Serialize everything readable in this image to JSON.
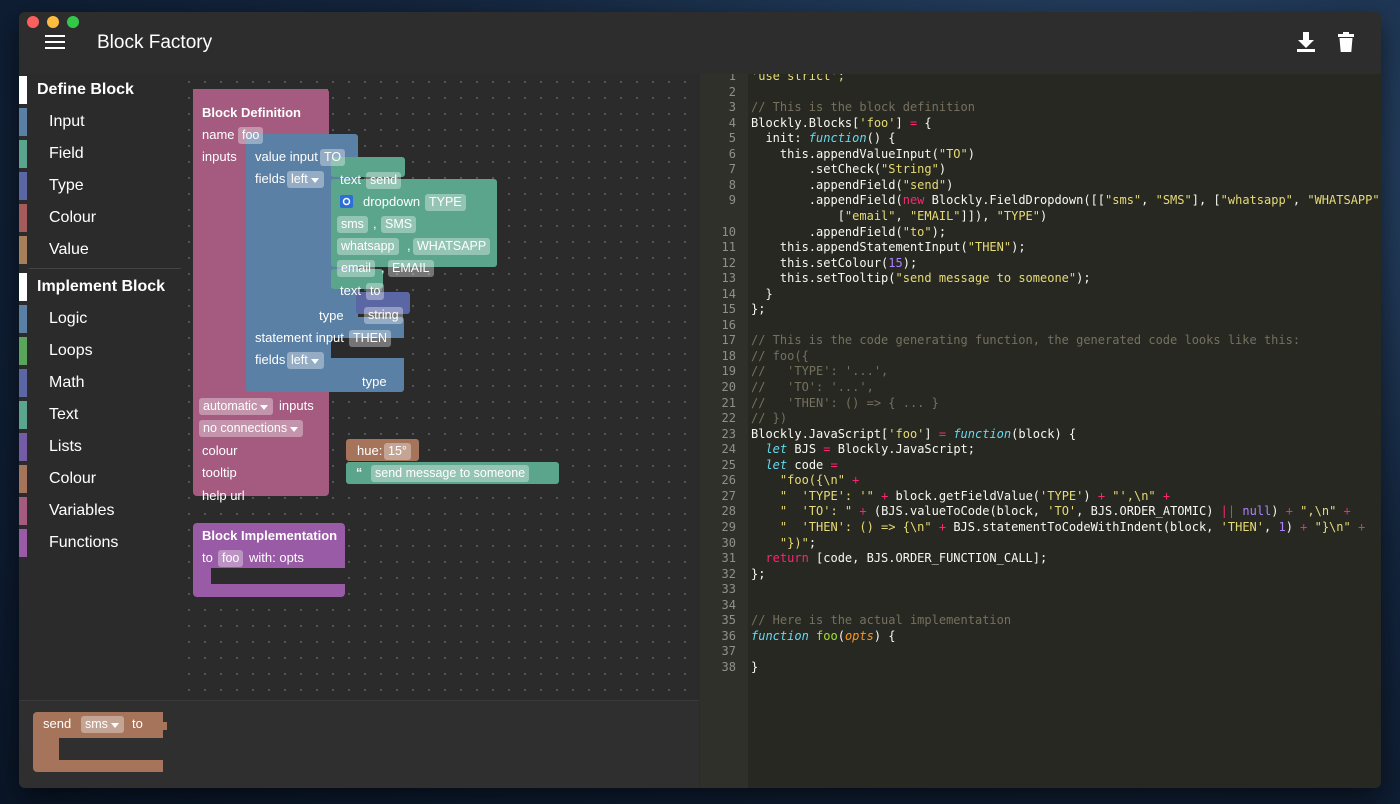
{
  "app": {
    "title": "Block Factory"
  },
  "toolbar": {
    "menu_icon": "hamburger-icon",
    "download_icon": "download-icon",
    "delete_icon": "trash-icon"
  },
  "sidebar": {
    "define": {
      "label": "Define Block",
      "items": [
        {
          "label": "Input",
          "color": "#5b80a5"
        },
        {
          "label": "Field",
          "color": "#5ba58c"
        },
        {
          "label": "Type",
          "color": "#5b67a5"
        },
        {
          "label": "Colour",
          "color": "#a55b5b"
        },
        {
          "label": "Value",
          "color": "#a5805b"
        }
      ]
    },
    "implement": {
      "label": "Implement Block",
      "items": [
        {
          "label": "Logic",
          "color": "#5b80a5"
        },
        {
          "label": "Loops",
          "color": "#5ba55b"
        },
        {
          "label": "Math",
          "color": "#5b67a5"
        },
        {
          "label": "Text",
          "color": "#5ba58c"
        },
        {
          "label": "Lists",
          "color": "#745ba5"
        },
        {
          "label": "Colour",
          "color": "#a5745b"
        },
        {
          "label": "Variables",
          "color": "#a55b80"
        },
        {
          "label": "Functions",
          "color": "#995ba5"
        }
      ]
    }
  },
  "def_block": {
    "title": "Block Definition",
    "name_label": "name",
    "name_value": "foo",
    "inputs_label": "inputs",
    "value_input_label": "value input",
    "value_input_name": "TO",
    "fields_label": "fields",
    "align_left": "left",
    "text_label": "text",
    "text_send": "send",
    "dropdown_label": "dropdown",
    "dropdown_name": "TYPE",
    "opt1_a": "sms",
    "opt1_b": "SMS",
    "opt2_a": "whatsapp",
    "opt2_b": "WHATSAPP",
    "opt3_a": "email",
    "opt3_b": "EMAIL",
    "comma": ",",
    "text_to": "to",
    "type_label": "type",
    "type_string": "string",
    "stmt_input_label": "statement input",
    "stmt_input_name": "THEN",
    "stmt_fields_label": "fields",
    "stmt_align": "left",
    "stmt_type_label": "type",
    "auto_inputs": "automatic",
    "inputs_word": "inputs",
    "connections": "no connections",
    "colour_label": "colour",
    "hue_label": "hue:",
    "hue_value": "15°",
    "tooltip_label": "tooltip",
    "quote": "“",
    "tooltip_value": "send message to someone",
    "helpurl_label": "help url"
  },
  "impl_block": {
    "title": "Block Implementation",
    "to_label": "to",
    "fn_name": "foo",
    "with_label": "with: opts"
  },
  "preview_block": {
    "send_label": "send",
    "dropdown_value": "sms",
    "to_label": "to"
  },
  "code": {
    "lines": [
      {
        "n": "1",
        "t": [
          {
            "c": "st",
            "v": "'use strict';"
          }
        ]
      },
      {
        "n": "2",
        "t": []
      },
      {
        "n": "3",
        "t": [
          {
            "c": "cm",
            "v": "// This is the block definition"
          }
        ]
      },
      {
        "n": "4",
        "t": [
          {
            "c": "pl",
            "v": "Blockly.Blocks["
          },
          {
            "c": "st",
            "v": "'foo'"
          },
          {
            "c": "pl",
            "v": "] "
          },
          {
            "c": "kw",
            "v": "="
          },
          {
            "c": "pl",
            "v": " {"
          }
        ]
      },
      {
        "n": "5",
        "t": [
          {
            "c": "pl",
            "v": "  init: "
          },
          {
            "c": "fn",
            "v": "function"
          },
          {
            "c": "pl",
            "v": "() {"
          }
        ]
      },
      {
        "n": "6",
        "t": [
          {
            "c": "pl",
            "v": "    this.appendValueInput("
          },
          {
            "c": "st",
            "v": "\"TO\""
          },
          {
            "c": "pl",
            "v": ")"
          }
        ]
      },
      {
        "n": "7",
        "t": [
          {
            "c": "pl",
            "v": "        .setCheck("
          },
          {
            "c": "st",
            "v": "\"String\""
          },
          {
            "c": "pl",
            "v": ")"
          }
        ]
      },
      {
        "n": "8",
        "t": [
          {
            "c": "pl",
            "v": "        .appendField("
          },
          {
            "c": "st",
            "v": "\"send\""
          },
          {
            "c": "pl",
            "v": ")"
          }
        ]
      },
      {
        "n": "9",
        "t": [
          {
            "c": "pl",
            "v": "        .appendField("
          },
          {
            "c": "kw",
            "v": "new"
          },
          {
            "c": "pl",
            "v": " Blockly.FieldDropdown([["
          },
          {
            "c": "st",
            "v": "\"sms\""
          },
          {
            "c": "pl",
            "v": ", "
          },
          {
            "c": "st",
            "v": "\"SMS\""
          },
          {
            "c": "pl",
            "v": "], ["
          },
          {
            "c": "st",
            "v": "\"whatsapp\""
          },
          {
            "c": "pl",
            "v": ", "
          },
          {
            "c": "st",
            "v": "\"WHATSAPP\""
          },
          {
            "c": "pl",
            "v": "],"
          }
        ]
      },
      {
        "n": "",
        "t": [
          {
            "c": "pl",
            "v": "            ["
          },
          {
            "c": "st",
            "v": "\"email\""
          },
          {
            "c": "pl",
            "v": ", "
          },
          {
            "c": "st",
            "v": "\"EMAIL\""
          },
          {
            "c": "pl",
            "v": "]]), "
          },
          {
            "c": "st",
            "v": "\"TYPE\""
          },
          {
            "c": "pl",
            "v": ")"
          }
        ]
      },
      {
        "n": "10",
        "t": [
          {
            "c": "pl",
            "v": "        .appendField("
          },
          {
            "c": "st",
            "v": "\"to\""
          },
          {
            "c": "pl",
            "v": ");"
          }
        ]
      },
      {
        "n": "11",
        "t": [
          {
            "c": "pl",
            "v": "    this.appendStatementInput("
          },
          {
            "c": "st",
            "v": "\"THEN\""
          },
          {
            "c": "pl",
            "v": ");"
          }
        ]
      },
      {
        "n": "12",
        "t": [
          {
            "c": "pl",
            "v": "    this.setColour("
          },
          {
            "c": "nu",
            "v": "15"
          },
          {
            "c": "pl",
            "v": ");"
          }
        ]
      },
      {
        "n": "13",
        "t": [
          {
            "c": "pl",
            "v": "    this.setTooltip("
          },
          {
            "c": "st",
            "v": "\"send message to someone\""
          },
          {
            "c": "pl",
            "v": ");"
          }
        ]
      },
      {
        "n": "14",
        "t": [
          {
            "c": "pl",
            "v": "  }"
          }
        ]
      },
      {
        "n": "15",
        "t": [
          {
            "c": "pl",
            "v": "};"
          }
        ]
      },
      {
        "n": "16",
        "t": []
      },
      {
        "n": "17",
        "t": [
          {
            "c": "cm",
            "v": "// This is the code generating function, the generated code looks like this:"
          }
        ]
      },
      {
        "n": "18",
        "t": [
          {
            "c": "cm",
            "v": "// foo({"
          }
        ]
      },
      {
        "n": "19",
        "t": [
          {
            "c": "cm",
            "v": "//   'TYPE': '...',"
          }
        ]
      },
      {
        "n": "20",
        "t": [
          {
            "c": "cm",
            "v": "//   'TO': '...',"
          }
        ]
      },
      {
        "n": "21",
        "t": [
          {
            "c": "cm",
            "v": "//   'THEN': () => { ... }"
          }
        ]
      },
      {
        "n": "22",
        "t": [
          {
            "c": "cm",
            "v": "// })"
          }
        ]
      },
      {
        "n": "23",
        "t": [
          {
            "c": "pl",
            "v": "Blockly.JavaScript["
          },
          {
            "c": "st",
            "v": "'foo'"
          },
          {
            "c": "pl",
            "v": "] "
          },
          {
            "c": "kw",
            "v": "="
          },
          {
            "c": "pl",
            "v": " "
          },
          {
            "c": "fn",
            "v": "function"
          },
          {
            "c": "pl",
            "v": "(block) {"
          }
        ]
      },
      {
        "n": "24",
        "t": [
          {
            "c": "pl",
            "v": "  "
          },
          {
            "c": "fn",
            "v": "let"
          },
          {
            "c": "pl",
            "v": " BJS "
          },
          {
            "c": "kw",
            "v": "="
          },
          {
            "c": "pl",
            "v": " Blockly.JavaScript;"
          }
        ]
      },
      {
        "n": "25",
        "t": [
          {
            "c": "pl",
            "v": "  "
          },
          {
            "c": "fn",
            "v": "let"
          },
          {
            "c": "pl",
            "v": " code "
          },
          {
            "c": "kw",
            "v": "="
          }
        ]
      },
      {
        "n": "26",
        "t": [
          {
            "c": "pl",
            "v": "    "
          },
          {
            "c": "st",
            "v": "\"foo({\\n\""
          },
          {
            "c": "pl",
            "v": " "
          },
          {
            "c": "kw",
            "v": "+"
          }
        ]
      },
      {
        "n": "27",
        "t": [
          {
            "c": "pl",
            "v": "    "
          },
          {
            "c": "st",
            "v": "\"  'TYPE': '\""
          },
          {
            "c": "pl",
            "v": " "
          },
          {
            "c": "kw",
            "v": "+"
          },
          {
            "c": "pl",
            "v": " block.getFieldValue("
          },
          {
            "c": "st",
            "v": "'TYPE'"
          },
          {
            "c": "pl",
            "v": ") "
          },
          {
            "c": "kw",
            "v": "+"
          },
          {
            "c": "pl",
            "v": " "
          },
          {
            "c": "st",
            "v": "\"',\\n\""
          },
          {
            "c": "pl",
            "v": " "
          },
          {
            "c": "kw",
            "v": "+"
          }
        ]
      },
      {
        "n": "28",
        "t": [
          {
            "c": "pl",
            "v": "    "
          },
          {
            "c": "st",
            "v": "\"  'TO': \""
          },
          {
            "c": "pl",
            "v": " "
          },
          {
            "c": "kw",
            "v": "+"
          },
          {
            "c": "pl",
            "v": " (BJS.valueToCode(block, "
          },
          {
            "c": "st",
            "v": "'TO'"
          },
          {
            "c": "pl",
            "v": ", BJS.ORDER_ATOMIC) "
          },
          {
            "c": "kw",
            "v": "||"
          },
          {
            "c": "pl",
            "v": " "
          },
          {
            "c": "nu",
            "v": "null"
          },
          {
            "c": "pl",
            "v": ") "
          },
          {
            "c": "kw",
            "v": "+"
          },
          {
            "c": "pl",
            "v": " "
          },
          {
            "c": "st",
            "v": "\",\\n\""
          },
          {
            "c": "pl",
            "v": " "
          },
          {
            "c": "kw",
            "v": "+"
          }
        ]
      },
      {
        "n": "29",
        "t": [
          {
            "c": "pl",
            "v": "    "
          },
          {
            "c": "st",
            "v": "\"  'THEN': () => {\\n\""
          },
          {
            "c": "pl",
            "v": " "
          },
          {
            "c": "kw",
            "v": "+"
          },
          {
            "c": "pl",
            "v": " BJS.statementToCodeWithIndent(block, "
          },
          {
            "c": "st",
            "v": "'THEN'"
          },
          {
            "c": "pl",
            "v": ", "
          },
          {
            "c": "nu",
            "v": "1"
          },
          {
            "c": "pl",
            "v": ") "
          },
          {
            "c": "kw",
            "v": "+"
          },
          {
            "c": "pl",
            "v": " "
          },
          {
            "c": "st",
            "v": "\"}\\n\""
          },
          {
            "c": "pl",
            "v": " "
          },
          {
            "c": "kw",
            "v": "+"
          }
        ]
      },
      {
        "n": "30",
        "t": [
          {
            "c": "pl",
            "v": "    "
          },
          {
            "c": "st",
            "v": "\"})\""
          },
          {
            "c": "pl",
            "v": ";"
          }
        ]
      },
      {
        "n": "31",
        "t": [
          {
            "c": "pl",
            "v": "  "
          },
          {
            "c": "kw",
            "v": "return"
          },
          {
            "c": "pl",
            "v": " [code, BJS.ORDER_FUNCTION_CALL];"
          }
        ]
      },
      {
        "n": "32",
        "t": [
          {
            "c": "pl",
            "v": "};"
          }
        ]
      },
      {
        "n": "33",
        "t": []
      },
      {
        "n": "34",
        "t": []
      },
      {
        "n": "35",
        "t": [
          {
            "c": "cm",
            "v": "// Here is the actual implementation"
          }
        ]
      },
      {
        "n": "36",
        "t": [
          {
            "c": "fn",
            "v": "function"
          },
          {
            "c": "pl",
            "v": " "
          },
          {
            "c": "t-fnname",
            "v": "foo"
          },
          {
            "c": "pl",
            "v": "("
          },
          {
            "c": "pa",
            "v": "opts"
          },
          {
            "c": "pl",
            "v": ") {"
          }
        ]
      },
      {
        "n": "37",
        "t": []
      },
      {
        "n": "38",
        "t": [
          {
            "c": "pl",
            "v": "}"
          }
        ]
      }
    ]
  },
  "colors": {
    "def_block": "#a55b80",
    "input_block": "#5b80a5",
    "field_block": "#5ba58c",
    "type_block": "#5b67a5",
    "colour_block": "#a5745b",
    "impl_block": "#995ba5",
    "preview_block": "#a5745b"
  }
}
